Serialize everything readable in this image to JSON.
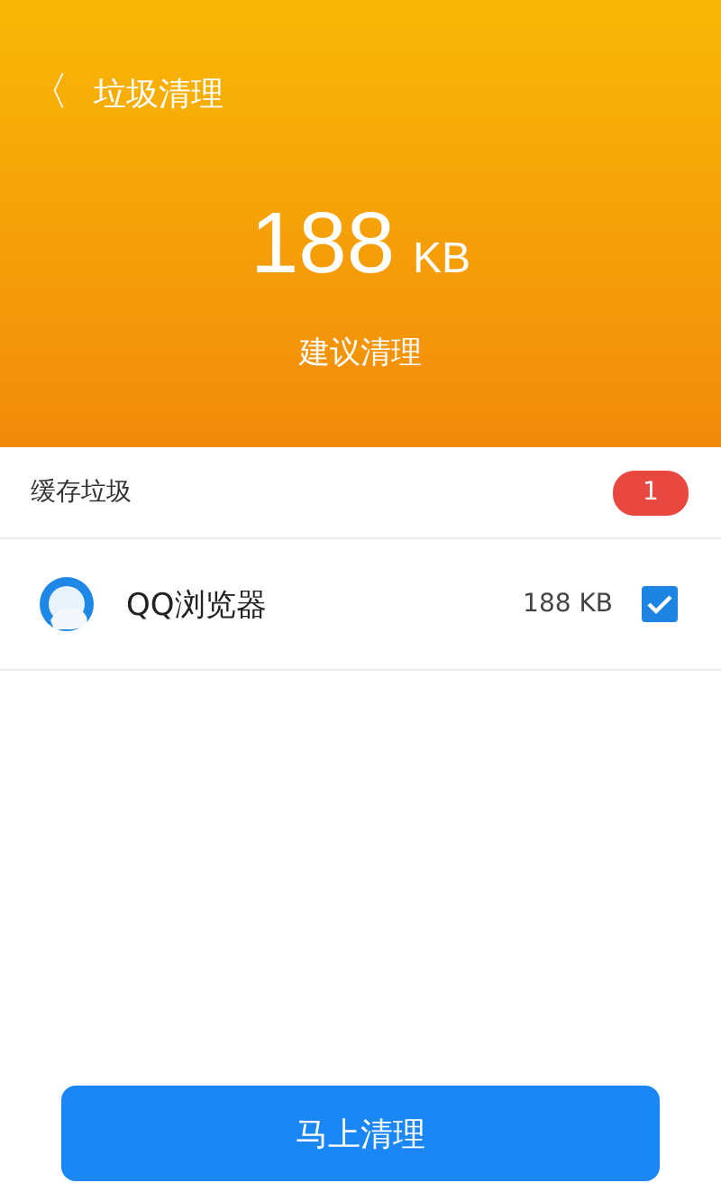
{
  "header": {
    "back_icon": "〈",
    "title": "垃圾清理",
    "size_value": "188",
    "size_unit": "KB",
    "advice": "建议清理"
  },
  "section": {
    "title": "缓存垃圾",
    "count": "1"
  },
  "items": [
    {
      "name": "QQ浏览器",
      "size": "188 KB",
      "checked": true
    }
  ],
  "action_button": "马上清理"
}
